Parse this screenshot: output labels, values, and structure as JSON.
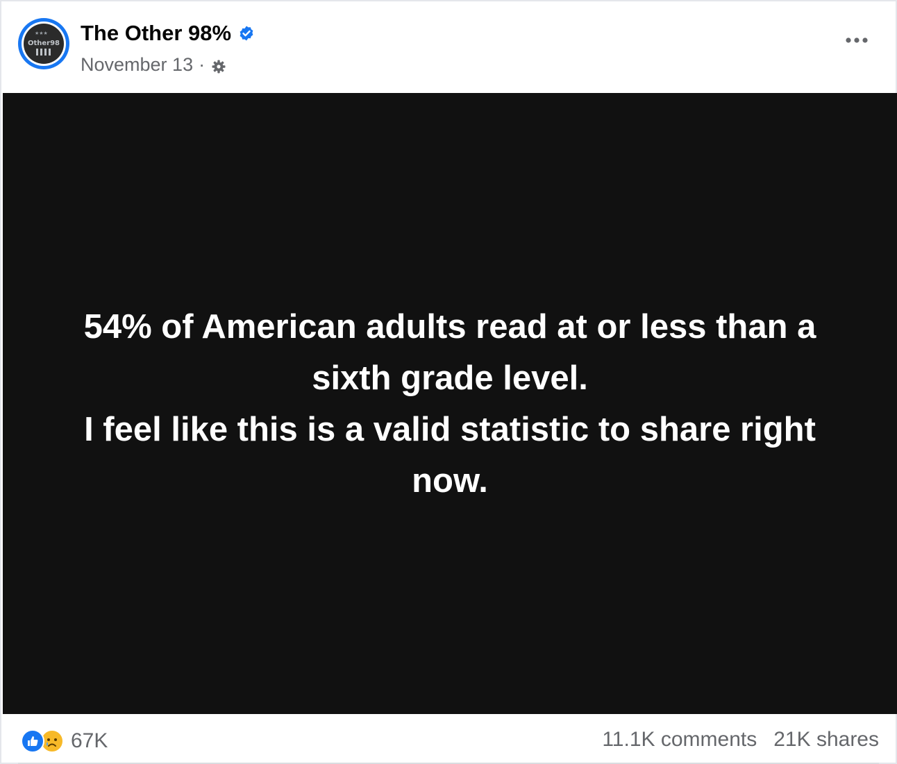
{
  "post": {
    "page_name": "The Other 98%",
    "avatar_text": "Other98",
    "date": "November 13",
    "separator": "·",
    "verified_icon": "verified-badge-icon",
    "privacy_icon": "gear-icon",
    "more_icon": "more-options-icon",
    "image_text_lines": [
      "54% of American adults read at or less than a",
      "sixth grade level.",
      "I feel like this is a valid statistic to share right",
      "now."
    ],
    "reactions": {
      "icons": [
        "like-icon",
        "sad-icon"
      ],
      "count": "67K"
    },
    "comments": "11.1K comments",
    "shares": "21K shares"
  },
  "colors": {
    "brand_blue": "#1877f2",
    "image_background": "#111111",
    "secondary_text": "#65676b"
  }
}
